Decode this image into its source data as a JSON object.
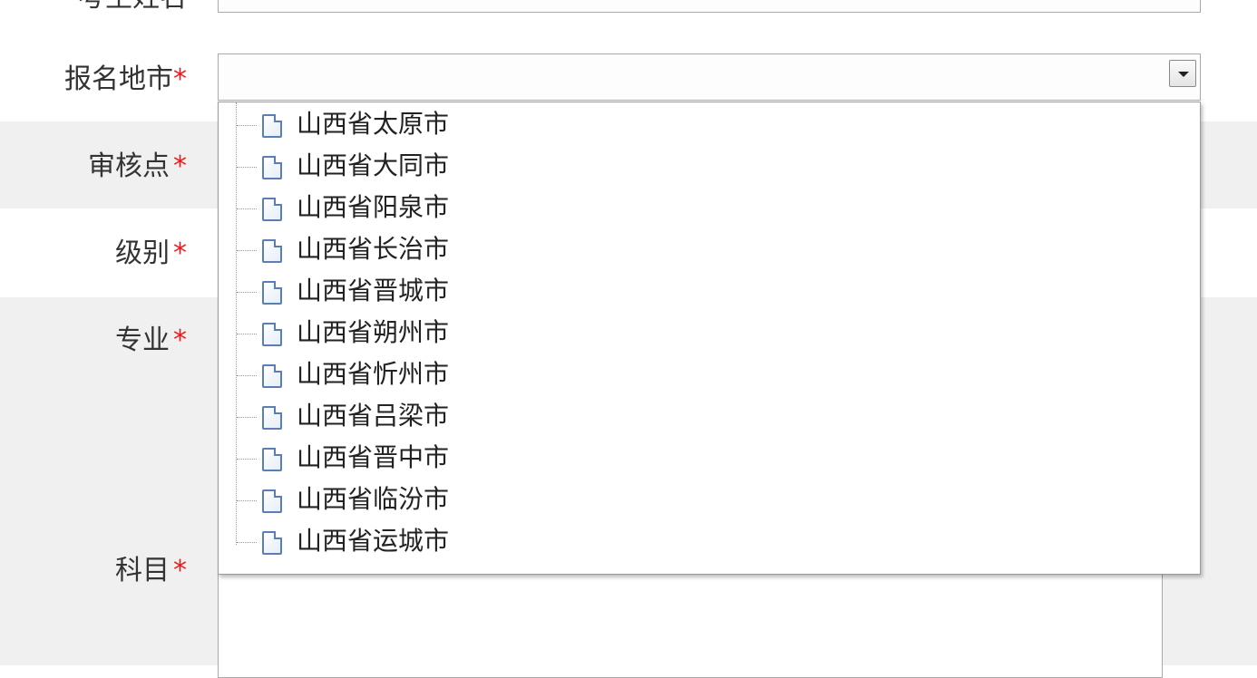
{
  "form": {
    "top_label_partial": "考生姓名",
    "required_mark": "*",
    "fields": [
      {
        "label": "报名地市",
        "value": ""
      },
      {
        "label": "审核点"
      },
      {
        "label": "级别"
      },
      {
        "label": "专业"
      },
      {
        "label": "科目"
      }
    ]
  },
  "dropdown": {
    "options": [
      "山西省太原市",
      "山西省大同市",
      "山西省阳泉市",
      "山西省长治市",
      "山西省晋城市",
      "山西省朔州市",
      "山西省忻州市",
      "山西省吕梁市",
      "山西省晋中市",
      "山西省临汾市",
      "山西省运城市"
    ]
  },
  "icons": {
    "option": "document-icon",
    "dropdown": "caret-down-icon"
  },
  "colors": {
    "required": "#e02020",
    "row_alt": "#f0f0f0",
    "icon_blue": "#5a7fb5"
  }
}
